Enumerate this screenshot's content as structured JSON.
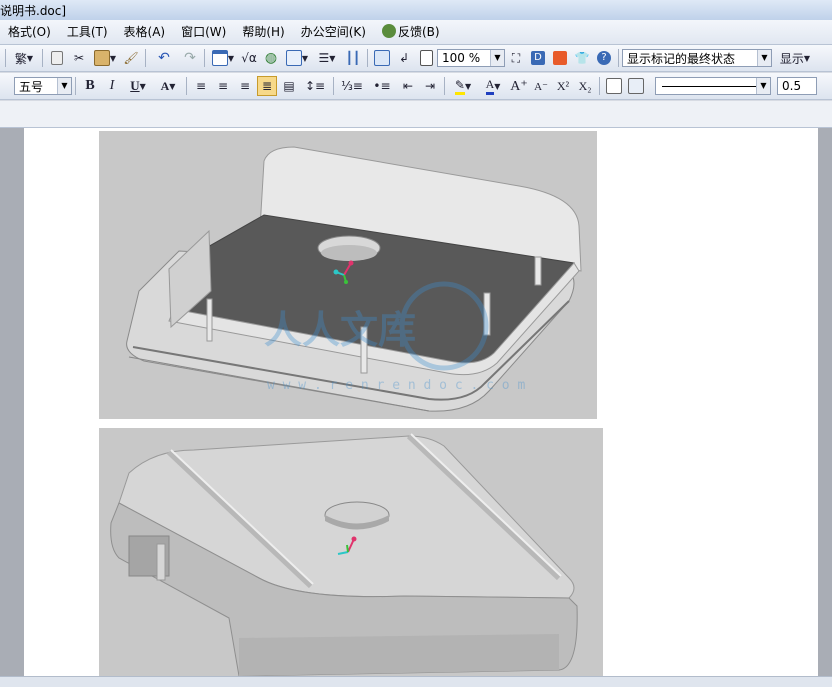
{
  "window": {
    "title": "说明书.doc]"
  },
  "menu": [
    {
      "id": "format",
      "label": "格式(O)"
    },
    {
      "id": "tools",
      "label": "工具(T)"
    },
    {
      "id": "table",
      "label": "表格(A)"
    },
    {
      "id": "window",
      "label": "窗口(W)"
    },
    {
      "id": "help",
      "label": "帮助(H)"
    },
    {
      "id": "office-space",
      "label": "办公空间(K)"
    },
    {
      "id": "feedback",
      "label": "反馈(B)"
    }
  ],
  "toolbar1": {
    "traditional_label": "繁",
    "zoom": "100 %",
    "markup_state": "显示标记的最终状态",
    "show_label": "显示"
  },
  "toolbar2": {
    "font_size": "五号",
    "bold_label": "B",
    "italic_label": "I",
    "underline_label": "U",
    "line_width": "0.5"
  },
  "watermark": {
    "text": "人人文库",
    "url": "w w w . r e n r e n d o c . c o m"
  }
}
